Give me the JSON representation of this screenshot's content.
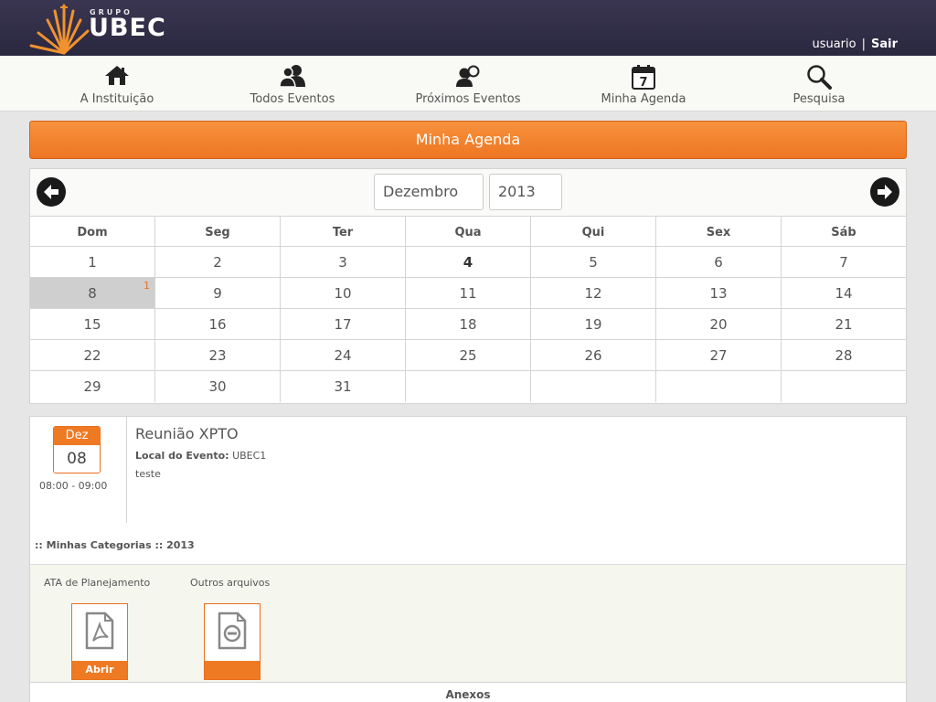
{
  "header": {
    "logo_small": "GRUPO",
    "logo_big": "UBEC",
    "user": "usuario",
    "separator": "|",
    "logout": "Sair"
  },
  "nav": [
    {
      "label": "A Instituição",
      "icon": "house-icon"
    },
    {
      "label": "Todos Eventos",
      "icon": "users-icon"
    },
    {
      "label": "Próximos Eventos",
      "icon": "user-search-icon"
    },
    {
      "label": "Minha Agenda",
      "icon": "calendar-icon",
      "icon_text": "7"
    },
    {
      "label": "Pesquisa",
      "icon": "magnifier-icon"
    }
  ],
  "page_title": "Minha Agenda",
  "calendar": {
    "month": "Dezembro",
    "year": "2013",
    "weekdays": [
      "Dom",
      "Seg",
      "Ter",
      "Qua",
      "Qui",
      "Sex",
      "Sáb"
    ],
    "weeks": [
      [
        "1",
        "2",
        "3",
        "4",
        "5",
        "6",
        "7"
      ],
      [
        "8",
        "9",
        "10",
        "11",
        "12",
        "13",
        "14"
      ],
      [
        "15",
        "16",
        "17",
        "18",
        "19",
        "20",
        "21"
      ],
      [
        "22",
        "23",
        "24",
        "25",
        "26",
        "27",
        "28"
      ],
      [
        "29",
        "30",
        "31",
        "",
        "",
        "",
        ""
      ]
    ],
    "today": "4",
    "selected": "8",
    "selected_count": "1"
  },
  "event": {
    "month": "Dez",
    "day": "08",
    "time": "08:00 - 09:00",
    "title": "Reunião XPTO",
    "local_label": "Local do Evento:",
    "local_value": "UBEC1",
    "description": "teste",
    "categories": ":: Minhas Categorias :: 2013"
  },
  "files": [
    {
      "label": "ATA de Planejamento",
      "icon": "pdf-file-icon",
      "button": "Abrir"
    },
    {
      "label": "Outros arquivos",
      "icon": "generic-file-icon",
      "button": ""
    }
  ],
  "anexos_label": "Anexos"
}
